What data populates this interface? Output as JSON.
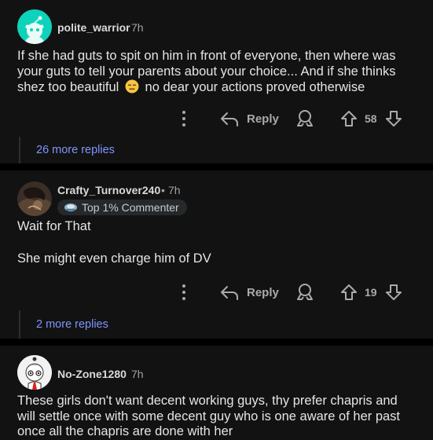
{
  "comments": [
    {
      "username": "polite_warrior",
      "time": "7h",
      "body_lines": [
        "If she had guts to spit on him in front of everyone, then where was",
        "your guts to tell your parents about your choice... And if she thinks",
        "shez too beautiful"
      ],
      "body_tail": "no dear your actions proved otherwise",
      "emoji": "expressionless-face-emoji",
      "reply_label": "Reply",
      "votes": "58",
      "more_replies": "26 more replies"
    },
    {
      "username": "Crafty_Turnover240",
      "separator": "•",
      "time": "7h",
      "badge": "Top 1% Commenter",
      "body_lines": [
        "Wait for That",
        "",
        "She might even charge him of DV"
      ],
      "reply_label": "Reply",
      "votes": "19",
      "more_replies": "2 more replies"
    },
    {
      "username": "No-Zone1280",
      "time": "7h",
      "body_lines": [
        "These girls don't want decent working guys, thy prefer chapris and",
        "will settle once with some decent guy who is one aware of her past",
        "once all the chapris are done with her"
      ]
    }
  ],
  "colors": {
    "card_bg": "#121212",
    "page_bg": "#000000",
    "text": "#e3e5e7",
    "muted": "#a8abad",
    "link": "#7f95ff",
    "snoo_bg": "#0dd3bb"
  },
  "icons": [
    "more-options-icon",
    "reply-arrow-icon",
    "award-icon",
    "upvote-icon",
    "downvote-icon"
  ]
}
